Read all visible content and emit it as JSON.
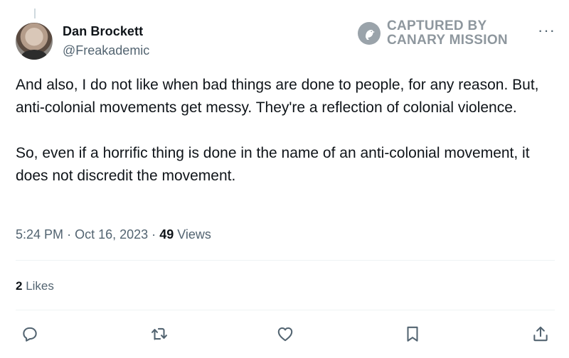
{
  "tweet": {
    "author": {
      "display_name": "Dan Brockett",
      "handle": "@Freakademic"
    },
    "paragraphs": [
      "And also, I do not like when bad things are done to people, for any reason. But, anti-colonial movements get messy. They're a reflection of colonial violence.",
      "So, even if a horrific thing is done in the name of an anti-colonial movement, it does not discredit the movement."
    ],
    "time": "5:24 PM",
    "date": "Oct 16, 2023",
    "separator": "·",
    "views_count": "49",
    "views_label": "Views",
    "likes_count": "2",
    "likes_label": "Likes"
  },
  "watermark": {
    "line1": "CAPTURED BY",
    "line2": "CANARY MISSION"
  },
  "menu": {
    "more_label": "···"
  },
  "actions": [
    {
      "icon": "reply-icon"
    },
    {
      "icon": "repost-icon"
    },
    {
      "icon": "like-icon"
    },
    {
      "icon": "bookmark-icon"
    },
    {
      "icon": "share-icon"
    }
  ],
  "colors": {
    "text": "#0f1419",
    "secondary": "#536471",
    "divider": "#eff3f4",
    "watermark": "#8e979e"
  }
}
